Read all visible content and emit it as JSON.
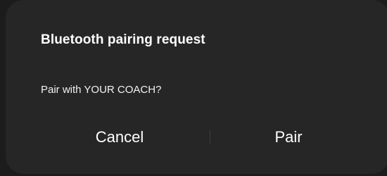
{
  "dialog": {
    "title": "Bluetooth pairing request",
    "message": "Pair with YOUR COACH?",
    "cancel_label": "Cancel",
    "confirm_label": "Pair"
  },
  "colors": {
    "background": "#1c1c1c",
    "dialog_surface": "#262626",
    "text": "#ffffff",
    "divider": "#3b3b3b"
  }
}
